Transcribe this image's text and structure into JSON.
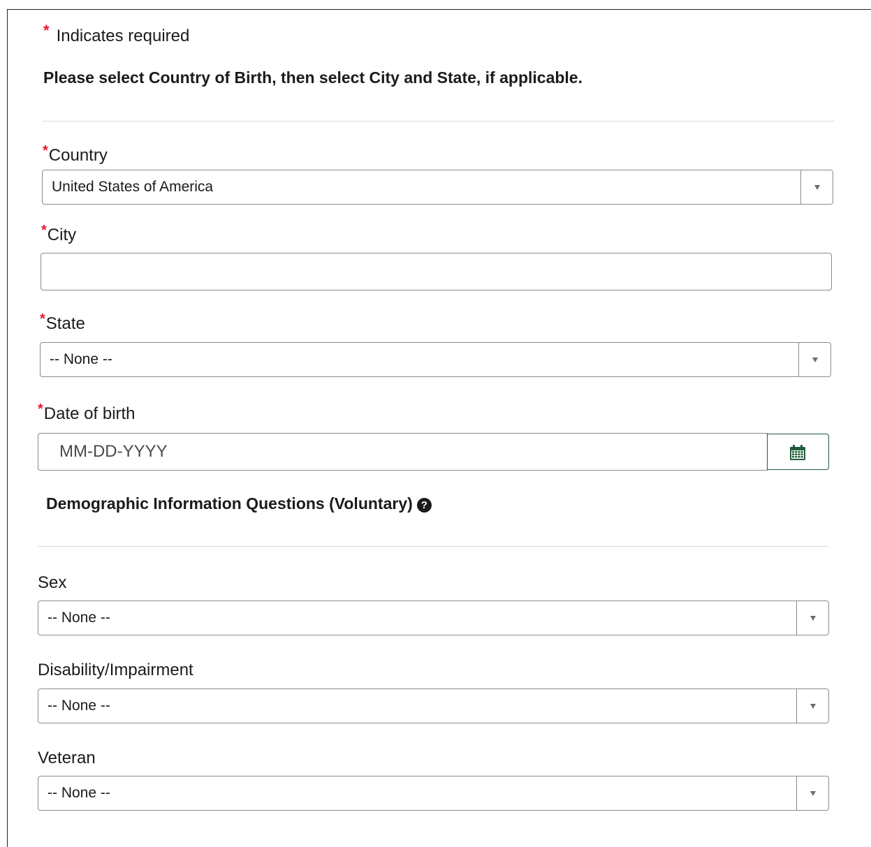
{
  "required_note": {
    "star": "*",
    "text": "Indicates required"
  },
  "instruction": "Please select Country of Birth, then select City and State, if applicable.",
  "fields": {
    "country": {
      "star": "*",
      "label": "Country",
      "value": "United States of America"
    },
    "city": {
      "star": "*",
      "label": "City",
      "value": ""
    },
    "state": {
      "star": "*",
      "label": "State",
      "value": "-- None --"
    },
    "date_of_birth": {
      "star": "*",
      "label": "Date of birth",
      "placeholder": "MM-DD-YYYY"
    }
  },
  "demographic": {
    "heading": "Demographic Information Questions (Voluntary)",
    "help_icon_glyph": "?",
    "sex": {
      "label": "Sex",
      "value": "-- None --"
    },
    "disability": {
      "label": "Disability/Impairment",
      "value": "-- None --"
    },
    "veteran": {
      "label": "Veteran",
      "value": "-- None --"
    }
  },
  "icons": {
    "dropdown": "chevron-down-icon",
    "calendar": "calendar-icon",
    "help": "question-circle-icon"
  },
  "colors": {
    "required": "#e3172d",
    "calendar_accent": "#1f5d3a",
    "border": "#8a8a8a",
    "divider": "#dcdcdc"
  }
}
